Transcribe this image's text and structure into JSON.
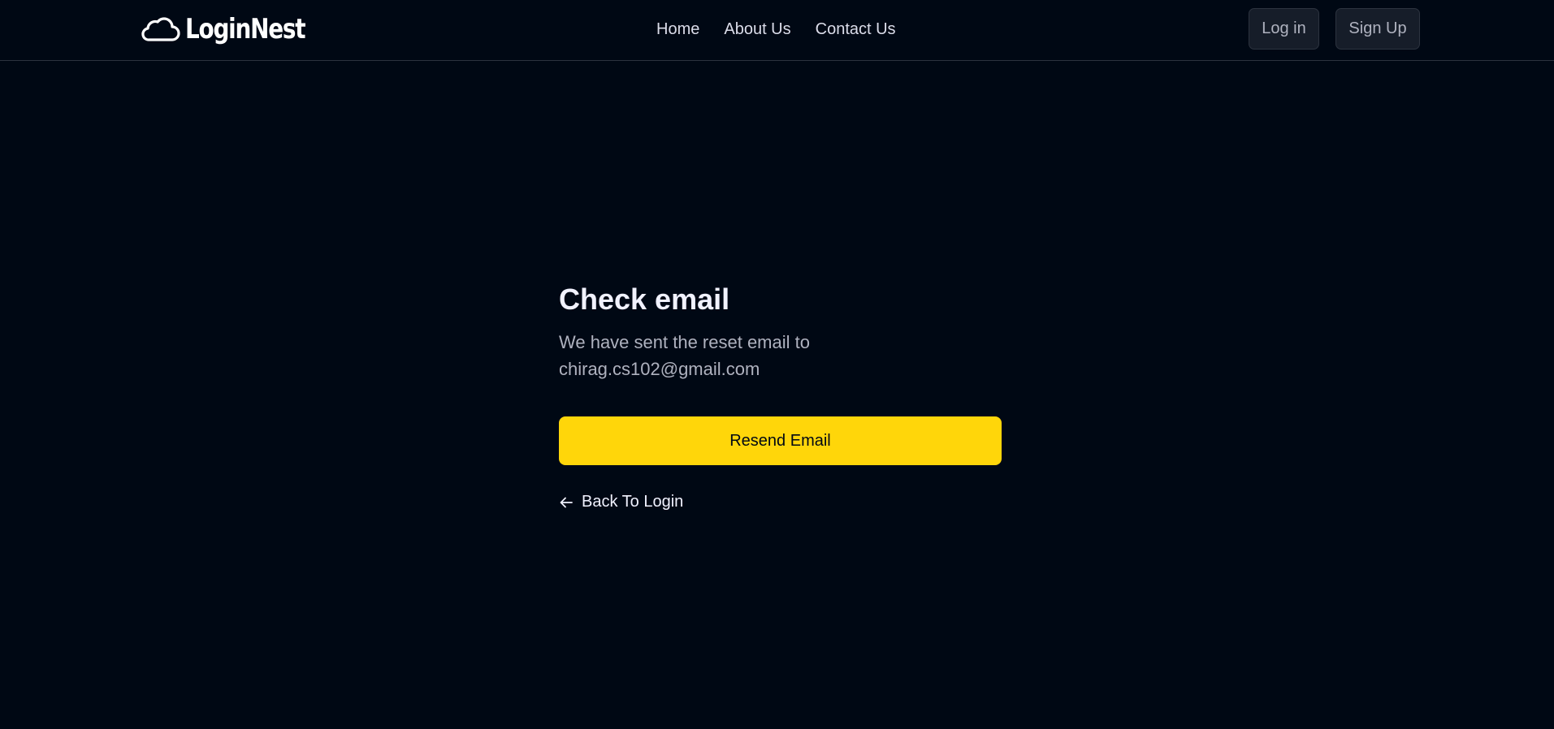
{
  "header": {
    "logo_text": "LoginNest",
    "nav": [
      {
        "label": "Home"
      },
      {
        "label": "About Us"
      },
      {
        "label": "Contact Us"
      }
    ],
    "login_label": "Log in",
    "signup_label": "Sign Up"
  },
  "main": {
    "title": "Check email",
    "description_line1": "We have sent the reset email to",
    "email": "chirag.cs102@gmail.com",
    "resend_label": "Resend Email",
    "back_label": "Back To Login"
  },
  "colors": {
    "background": "#000814",
    "accent": "#ffd60a",
    "muted_text": "#afb2bf",
    "button_bg": "#161d29",
    "border": "#2c333f"
  },
  "icons": {
    "logo": "cloud-icon",
    "back": "arrow-left-icon"
  }
}
